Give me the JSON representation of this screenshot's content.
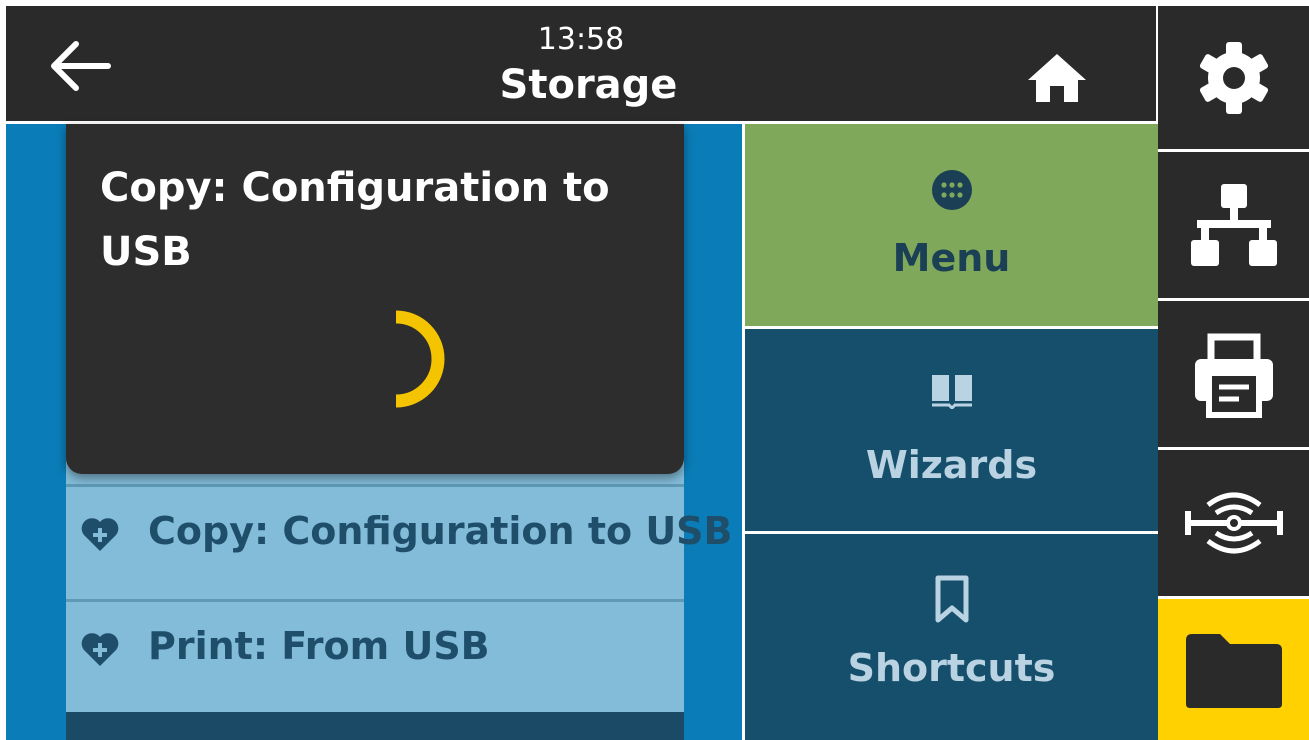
{
  "header": {
    "time": "13:58",
    "title": "Storage"
  },
  "dialog": {
    "title": "Copy: Configuration to USB",
    "spinner": "loading"
  },
  "list": {
    "items": [
      {
        "label": "Copy: Configuration to USB",
        "icon": "heart-plus-icon"
      },
      {
        "label": "Print: From USB",
        "icon": "heart-plus-icon"
      }
    ]
  },
  "nav": {
    "menu": {
      "label": "Menu",
      "icon": "grid-dots-icon"
    },
    "wizards": {
      "label": "Wizards",
      "icon": "open-book-icon"
    },
    "shortcuts": {
      "label": "Shortcuts",
      "icon": "bookmark-icon"
    }
  },
  "sidebar": {
    "items": [
      {
        "name": "settings",
        "icon": "gear-icon"
      },
      {
        "name": "network",
        "icon": "network-icon"
      },
      {
        "name": "print",
        "icon": "printer-icon"
      },
      {
        "name": "sensor",
        "icon": "sensor-icon"
      },
      {
        "name": "storage",
        "icon": "folder-icon",
        "active": true
      }
    ]
  },
  "colors": {
    "header_bg": "#2a2a2a",
    "menu_tile": "#7fa85a",
    "nav_tile": "#164f6b",
    "list_bg": "#83bcd8",
    "left_bar": "#0a7db8",
    "active_sidebar": "#ffd100",
    "spinner": "#f5c400"
  }
}
